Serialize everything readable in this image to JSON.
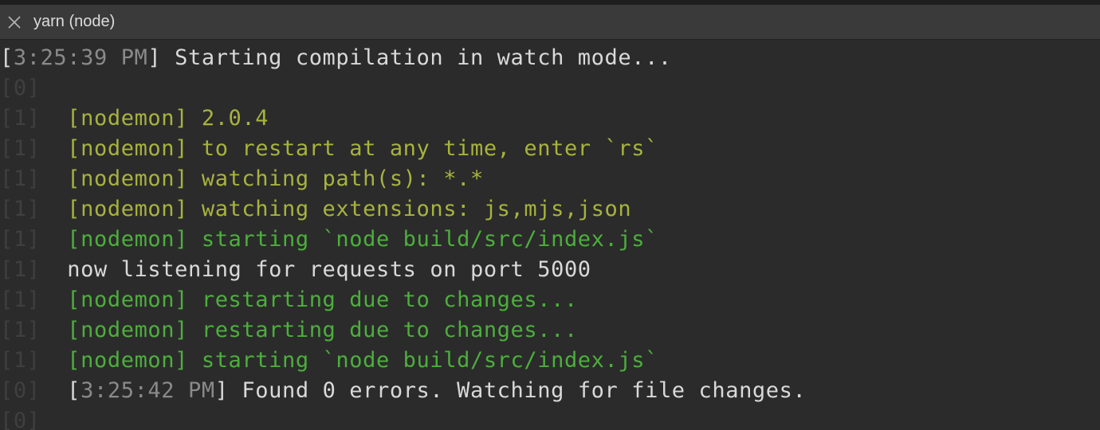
{
  "window": {
    "tab_title": "yarn (node)",
    "tab_close_icon": "close-icon"
  },
  "terminal": {
    "lines": [
      {
        "prefix": "",
        "ts_open": "[",
        "timestamp": "3:25:39 PM",
        "ts_close": "]",
        "text": " Starting compilation in watch mode..."
      },
      {
        "prefix": "[0]",
        "text": ""
      },
      {
        "prefix": "[1]",
        "text": "[nodemon] 2.0.4"
      },
      {
        "prefix": "[1]",
        "text": "[nodemon] to restart at any time, enter `rs`"
      },
      {
        "prefix": "[1]",
        "text": "[nodemon] watching path(s): *.*"
      },
      {
        "prefix": "[1]",
        "text": "[nodemon] watching extensions: js,mjs,json"
      },
      {
        "prefix": "[1]",
        "text": "[nodemon] starting `node build/src/index.js`"
      },
      {
        "prefix": "[1]",
        "text": "now listening for requests on port 5000"
      },
      {
        "prefix": "[1]",
        "text": "[nodemon] restarting due to changes..."
      },
      {
        "prefix": "[1]",
        "text": "[nodemon] restarting due to changes..."
      },
      {
        "prefix": "[1]",
        "text": "[nodemon] starting `node build/src/index.js`"
      },
      {
        "prefix": "[0]",
        "ts_open": "[",
        "timestamp": "3:25:42 PM",
        "ts_close": "]",
        "text": " Found 0 errors. Watching for file changes."
      },
      {
        "prefix": "[0]",
        "text": ""
      }
    ]
  },
  "colors": {
    "background": "#2b2b2b",
    "nodemon_yellow": "#a7b33d",
    "nodemon_green": "#4caf3c",
    "text": "#d9d9d9",
    "dim_prefix": "#3f3f3f"
  }
}
